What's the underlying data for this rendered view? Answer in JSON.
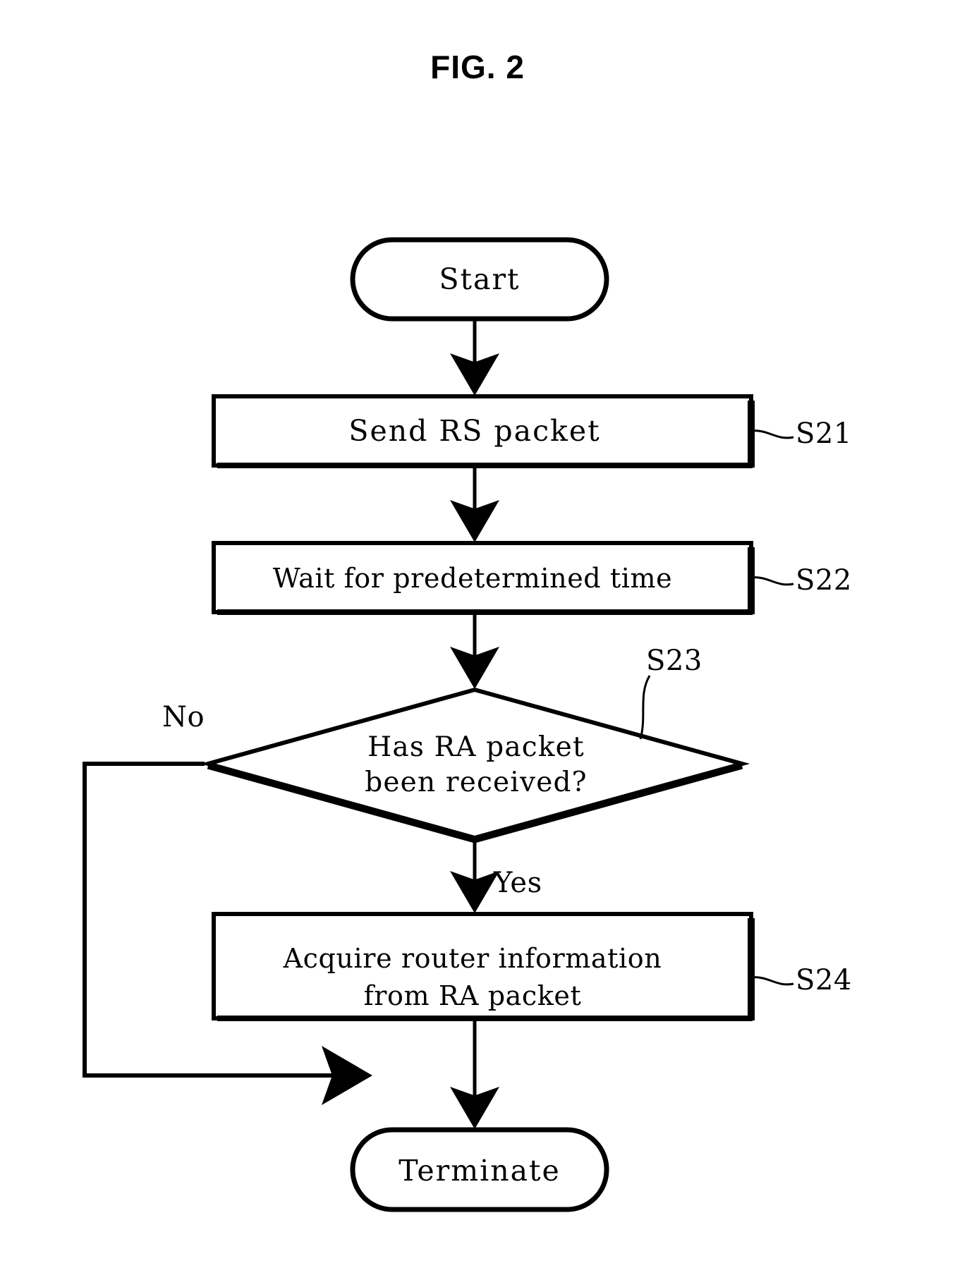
{
  "figure": {
    "title": "FIG. 2",
    "type": "flowchart"
  },
  "nodes": {
    "start": {
      "label": "Start",
      "shape": "stadium"
    },
    "s21": {
      "label": "Send RS packet",
      "ref": "S21",
      "shape": "process"
    },
    "s22": {
      "label": "Wait for predetermined time",
      "ref": "S22",
      "shape": "process"
    },
    "s23": {
      "label_line1": "Has RA packet",
      "label_line2": "been received?",
      "ref": "S23",
      "shape": "decision"
    },
    "s24": {
      "label_line1": "Acquire router information",
      "label_line2": "from RA packet",
      "ref": "S24",
      "shape": "process"
    },
    "terminate": {
      "label": "Terminate",
      "shape": "stadium"
    }
  },
  "branches": {
    "no": "No",
    "yes": "Yes"
  },
  "colors": {
    "ink": "#000000",
    "paper": "#ffffff"
  }
}
